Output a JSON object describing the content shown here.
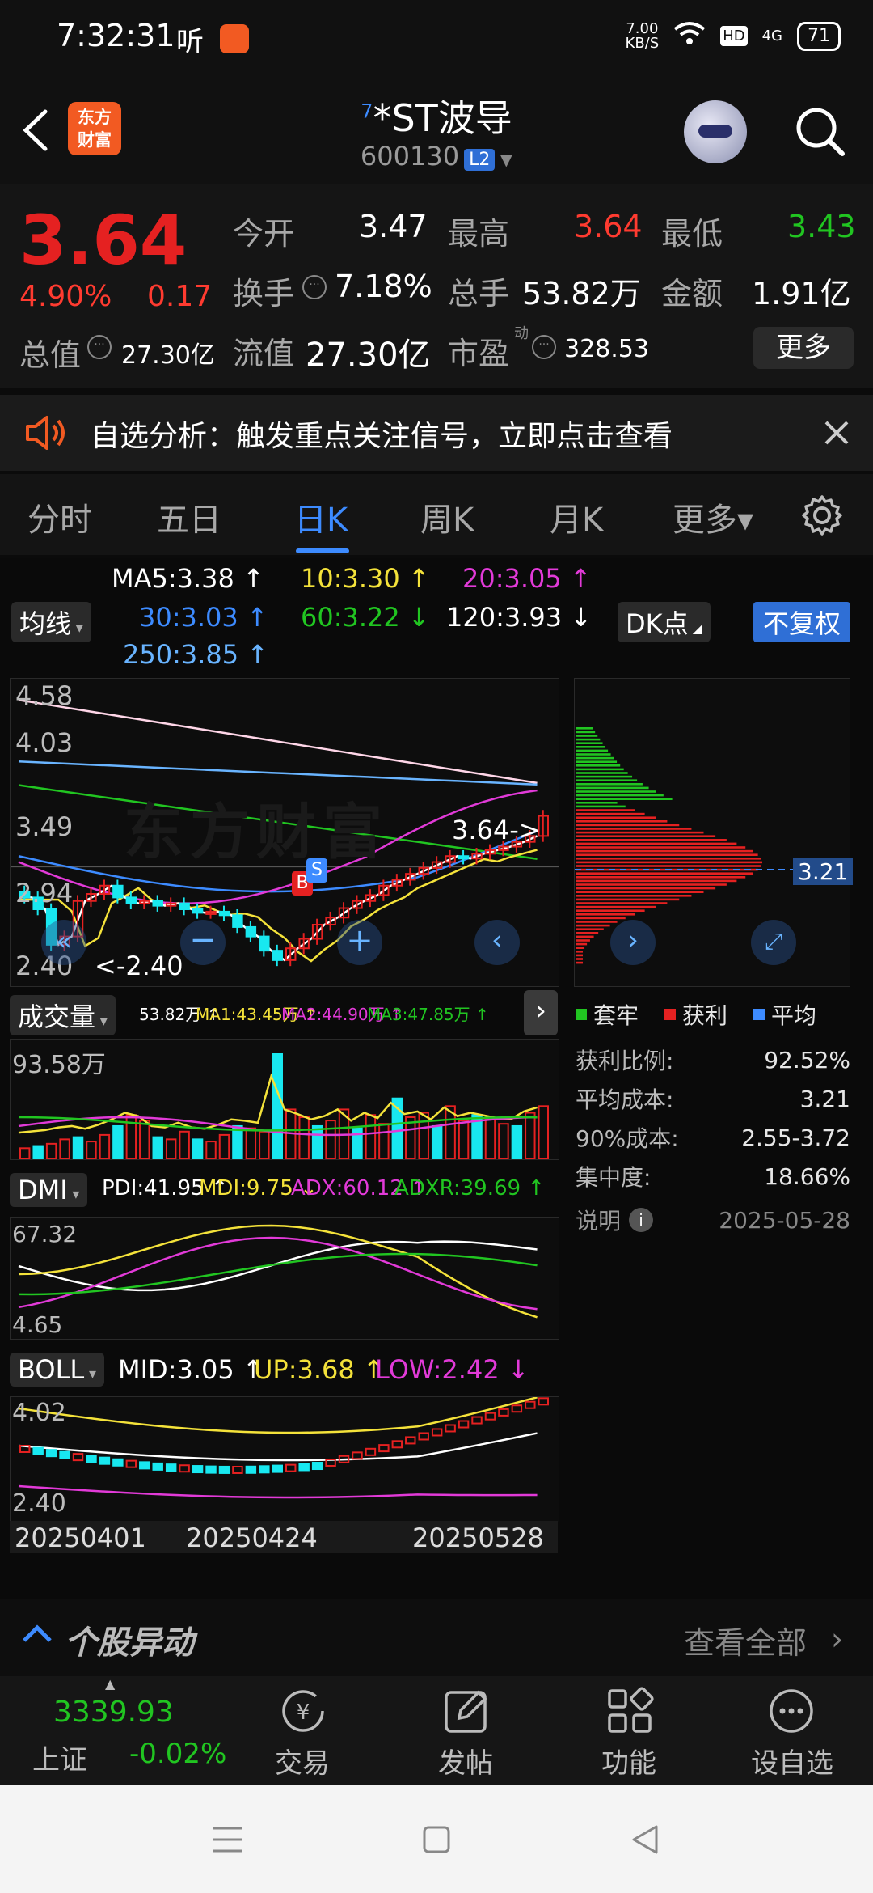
{
  "status": {
    "time": "7:32:31",
    "net_speed": "7.00\nKB/S",
    "battery": "71",
    "hd": "HD",
    "signal": "4G"
  },
  "header": {
    "logo_text": "东方\n财富",
    "superscript": "7",
    "title": "*ST波导",
    "code": "600130",
    "l2": "L2"
  },
  "quote": {
    "price": "3.64",
    "change_pct": "4.90%",
    "change": "0.17",
    "open_label": "今开",
    "open": "3.47",
    "high_label": "最高",
    "high": "3.64",
    "low_label": "最低",
    "low": "3.43",
    "turnover_label": "换手",
    "turnover": "7.18%",
    "volume_label": "总手",
    "volume": "53.82万",
    "amount_label": "金额",
    "amount": "1.91亿",
    "mktcap_label": "总值",
    "mktcap": "27.30亿",
    "float_label": "流值",
    "float_cap": "27.30亿",
    "pe_label": "市盈",
    "pe_sup": "动",
    "pe": "328.53",
    "more": "更多"
  },
  "alert": {
    "text": "自选分析：触发重点关注信号，立即点击查看"
  },
  "tabs": [
    "分时",
    "五日",
    "日K",
    "周K",
    "月K",
    "更多▾"
  ],
  "ma": {
    "toggle": "均线",
    "ma5": "MA5:3.38 ↑",
    "ma10": "10:3.30 ↑",
    "ma20": "20:3.05 ↑",
    "ma30": "30:3.03 ↑",
    "ma60": "60:3.22 ↓",
    "ma120": "120:3.93 ↓",
    "ma250": "250:3.85 ↑",
    "dk": "DK点",
    "adjust": "不复权"
  },
  "kchart": {
    "y_top": "4.58",
    "y_mid1": "4.03",
    "y_mid2": "3.49",
    "y_mid3": "2.94",
    "y_bot": "2.40",
    "last_label": "3.64->",
    "low_label": "<-2.40",
    "watermark": "东方财富",
    "b_marker": "B",
    "s_marker": "S"
  },
  "chip": {
    "avg": "3.21",
    "legend_taolao": "套牢",
    "legend_huoli": "获利",
    "legend_pingjun": "平均",
    "rows": [
      {
        "k": "获利比例:",
        "v": "92.52%"
      },
      {
        "k": "平均成本:",
        "v": "3.21"
      },
      {
        "k": "90%成本:",
        "v": "2.55-3.72"
      },
      {
        "k": "集中度:",
        "v": "18.66%"
      }
    ],
    "note": "说明",
    "date": "2025-05-28"
  },
  "volume": {
    "toggle": "成交量",
    "v": "53.82万 ↑",
    "ma1": "MA1:43.45万 ↑",
    "ma2": "MA2:44.90万 ↑",
    "ma3": "MA3:47.85万 ↑",
    "ymax": "93.58万"
  },
  "dmi": {
    "toggle": "DMI",
    "pdi": "PDI:41.95 ↑",
    "mdi": "MDI:9.75 ↓",
    "adx": "ADX:60.12 ↑",
    "adxr": "ADXR:39.69 ↑",
    "ytop": "67.32",
    "ybot": "4.65"
  },
  "boll": {
    "toggle": "BOLL",
    "mid": "MID:3.05 ↑",
    "up": "UP:3.68 ↑",
    "low": "LOW:2.42 ↓",
    "ytop": "4.02",
    "ybot": "2.40"
  },
  "dates": [
    "20250401",
    "20250424",
    "20250528"
  ],
  "yidong": {
    "title": "个股异动",
    "all": "查看全部"
  },
  "bottom": {
    "index_value": "3339.93",
    "index_name": "上证",
    "index_change": "-0.02%",
    "trade": "交易",
    "post": "发帖",
    "func": "功能",
    "addfav": "设自选"
  },
  "colors": {
    "red": "#e52121",
    "green": "#21c521",
    "blue": "#3d8bff",
    "cyan": "#18e8f0",
    "yellow": "#f4e23a",
    "magenta": "#e23ad8"
  }
}
